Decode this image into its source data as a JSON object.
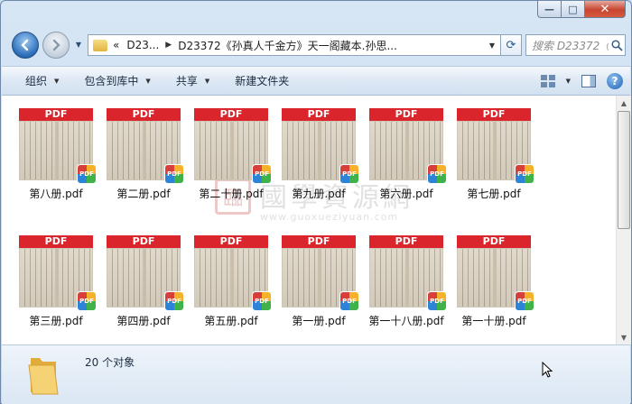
{
  "window": {
    "caption_buttons": {
      "minimize": "—",
      "maximize": "□",
      "close": "✕"
    }
  },
  "address": {
    "prefix": "«",
    "crumbs": [
      "D23...",
      "D23372《孙真人千金方》天一阁藏本.孙思..."
    ]
  },
  "search": {
    "placeholder": "搜索 D23372《..."
  },
  "toolbar": {
    "organize": "组织",
    "include_in_library": "包含到库中",
    "share": "共享",
    "new_folder": "新建文件夹"
  },
  "files": [
    {
      "name": "第八册.pdf",
      "band": "PDF"
    },
    {
      "name": "第二册.pdf",
      "band": "PDF"
    },
    {
      "name": "第二十册.pdf",
      "band": "PDF"
    },
    {
      "name": "第九册.pdf",
      "band": "PDF"
    },
    {
      "name": "第六册.pdf",
      "band": "PDF"
    },
    {
      "name": "第七册.pdf",
      "band": "PDF"
    },
    {
      "name": "第三册.pdf",
      "band": "PDF"
    },
    {
      "name": "第四册.pdf",
      "band": "PDF"
    },
    {
      "name": "第五册.pdf",
      "band": "PDF"
    },
    {
      "name": "第一册.pdf",
      "band": "PDF"
    },
    {
      "name": "第一十八册.pdf",
      "band": "PDF"
    },
    {
      "name": "第一十册.pdf",
      "band": "PDF"
    }
  ],
  "badge_text": "PDF",
  "watermark": {
    "seal": "臨",
    "title": "國學資源網",
    "url": "www.guoxueziyuan.com"
  },
  "status": {
    "count_text": "20 个对象"
  },
  "colors": {
    "pdf_band": "#d9252b",
    "window_frame": "#c4d8ee",
    "close_button": "#c8452f"
  }
}
